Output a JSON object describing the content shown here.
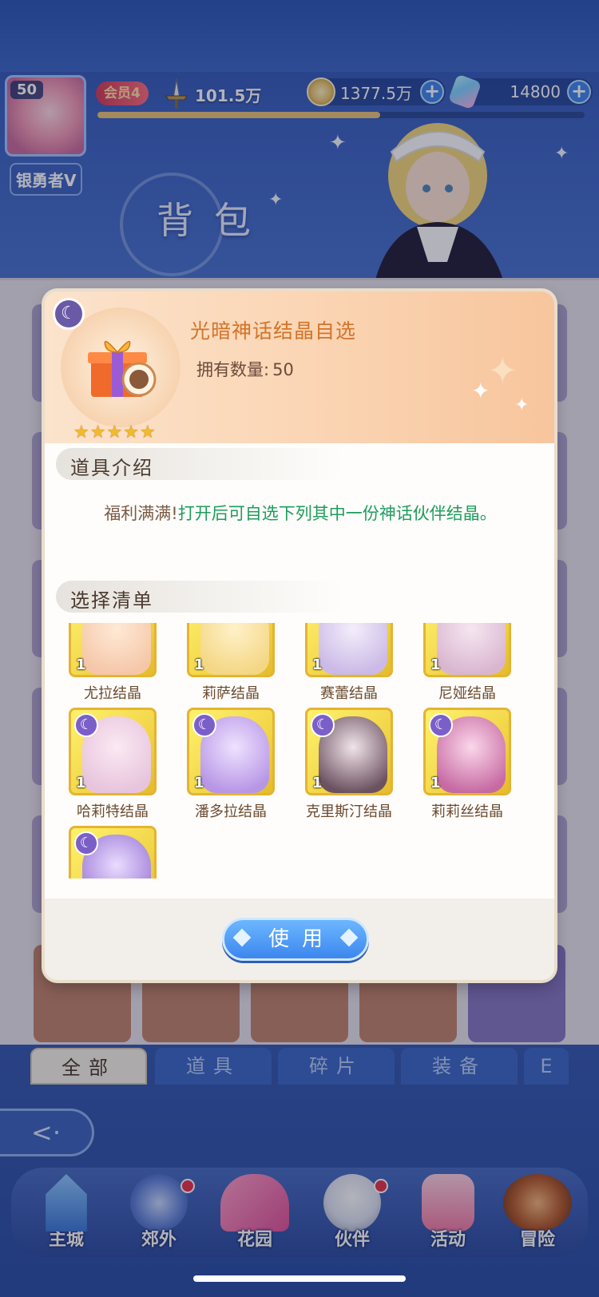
{
  "player": {
    "level": "50",
    "rank": "银勇者V",
    "vip": "会员4",
    "power": "101.5万",
    "exp_fraction": 0.58
  },
  "resources": [
    {
      "icon": "gold-coin-icon",
      "value": "1377.5万"
    },
    {
      "icon": "crystal-icon",
      "value": "14800"
    }
  ],
  "page_title": "背包",
  "item": {
    "name": "光暗神话结晶自选",
    "owned_label": "拥有数量:",
    "owned_value": "50",
    "stars": 5
  },
  "sections": {
    "intro": "道具介绍",
    "list": "选择清单"
  },
  "description": {
    "lead": "福利满满!",
    "body": "打开后可自选下列其中一份神话伙伴结晶。"
  },
  "choices": [
    {
      "label": "尤拉结晶",
      "count": "1"
    },
    {
      "label": "莉萨结晶",
      "count": "1"
    },
    {
      "label": "赛蕾结晶",
      "count": "1"
    },
    {
      "label": "尼娅结晶",
      "count": "1"
    },
    {
      "label": "哈莉特结晶",
      "count": "1"
    },
    {
      "label": "潘多拉结晶",
      "count": "1"
    },
    {
      "label": "克里斯汀结晶",
      "count": "1"
    },
    {
      "label": "莉莉丝结晶",
      "count": "1"
    },
    {
      "label": "",
      "count": ""
    }
  ],
  "use_button": "使用",
  "tabs": [
    "全部",
    "道具",
    "碎片",
    "装备",
    "E"
  ],
  "nav": [
    {
      "label": "主城",
      "dot": false
    },
    {
      "label": "郊外",
      "dot": true
    },
    {
      "label": "花园",
      "dot": false
    },
    {
      "label": "伙伴",
      "dot": true
    },
    {
      "label": "活动",
      "dot": false
    },
    {
      "label": "冒险",
      "dot": false
    }
  ],
  "colors": {
    "accent_blue": "#3d86ef",
    "item_name": "#d2742a",
    "desc_green": "#1f9c5c",
    "tile_gold": "#f2d548"
  }
}
